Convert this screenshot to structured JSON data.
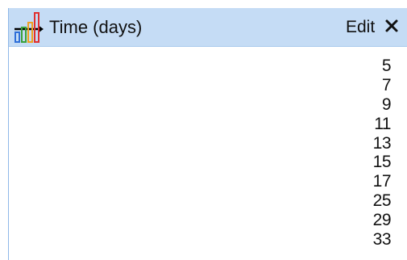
{
  "header": {
    "icon": "column-chart-icon",
    "title": "Time (days)",
    "edit_label": "Edit",
    "close_icon": "close-icon"
  },
  "colors": {
    "header_bg": "#c5dcf5",
    "border": "#8fb8e8",
    "bar_blue": "#2f6fd8",
    "bar_green": "#3aa23a",
    "bar_orange": "#f0a020",
    "bar_red": "#e03030"
  },
  "values": [
    "5",
    "7",
    "9",
    "11",
    "13",
    "15",
    "17",
    "25",
    "29",
    "33"
  ]
}
